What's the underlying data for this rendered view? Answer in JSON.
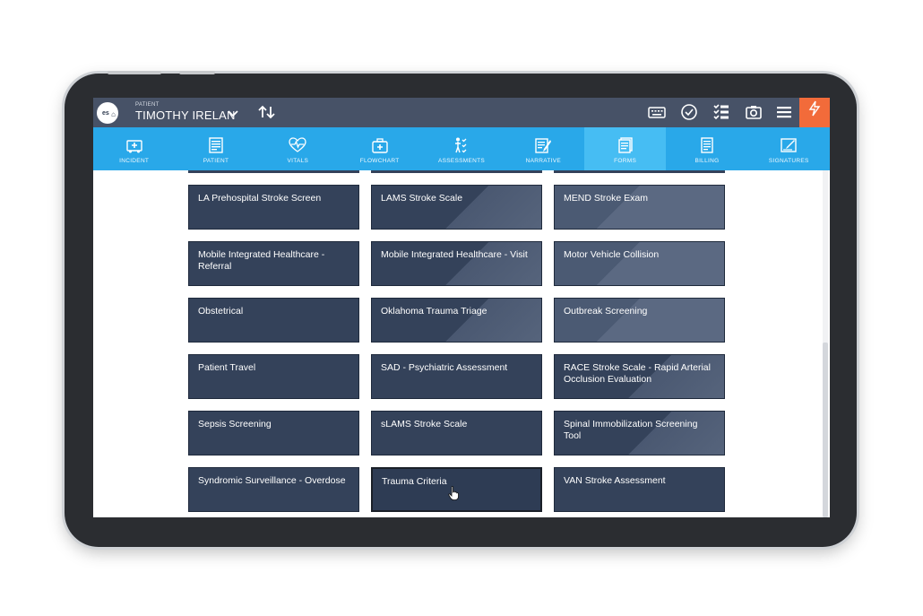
{
  "header": {
    "patient_caption": "PATIENT",
    "patient_name": "TIMOTHY IRELAN",
    "logo_text": "eso"
  },
  "nav": {
    "items": [
      {
        "label": "INCIDENT",
        "icon": "ambulance-icon"
      },
      {
        "label": "PATIENT",
        "icon": "patient-card-icon"
      },
      {
        "label": "VITALS",
        "icon": "heartbeat-icon"
      },
      {
        "label": "FLOWCHART",
        "icon": "medical-bag-icon"
      },
      {
        "label": "ASSESSMENTS",
        "icon": "assessment-icon"
      },
      {
        "label": "NARRATIVE",
        "icon": "narrative-pen-icon"
      },
      {
        "label": "FORMS",
        "icon": "forms-icon",
        "active": true
      },
      {
        "label": "BILLING",
        "icon": "billing-icon"
      },
      {
        "label": "SIGNATURES",
        "icon": "signature-icon"
      }
    ]
  },
  "forms": {
    "tiles": [
      {
        "label": "LA Prehospital Stroke Screen"
      },
      {
        "label": "LAMS Stroke Scale"
      },
      {
        "label": "MEND Stroke Exam"
      },
      {
        "label": "Mobile Integrated Healthcare - Referral"
      },
      {
        "label": "Mobile Integrated Healthcare - Visit"
      },
      {
        "label": "Motor Vehicle Collision"
      },
      {
        "label": "Obstetrical"
      },
      {
        "label": "Oklahoma Trauma Triage"
      },
      {
        "label": "Outbreak Screening"
      },
      {
        "label": "Patient Travel"
      },
      {
        "label": "SAD - Psychiatric Assessment"
      },
      {
        "label": "RACE Stroke Scale - Rapid Arterial Occlusion Evaluation"
      },
      {
        "label": "Sepsis Screening"
      },
      {
        "label": "sLAMS Stroke Scale"
      },
      {
        "label": "Spinal Immobilization Screening Tool"
      },
      {
        "label": "Syndromic Surveillance - Overdose"
      },
      {
        "label": "Trauma Criteria"
      },
      {
        "label": "VAN Stroke Assessment"
      }
    ]
  },
  "colors": {
    "topbar": "#475267",
    "navbar": "#29a8e9",
    "nav_active": "#46bdf3",
    "tile": "#34425a",
    "flash": "#f26b3a"
  }
}
